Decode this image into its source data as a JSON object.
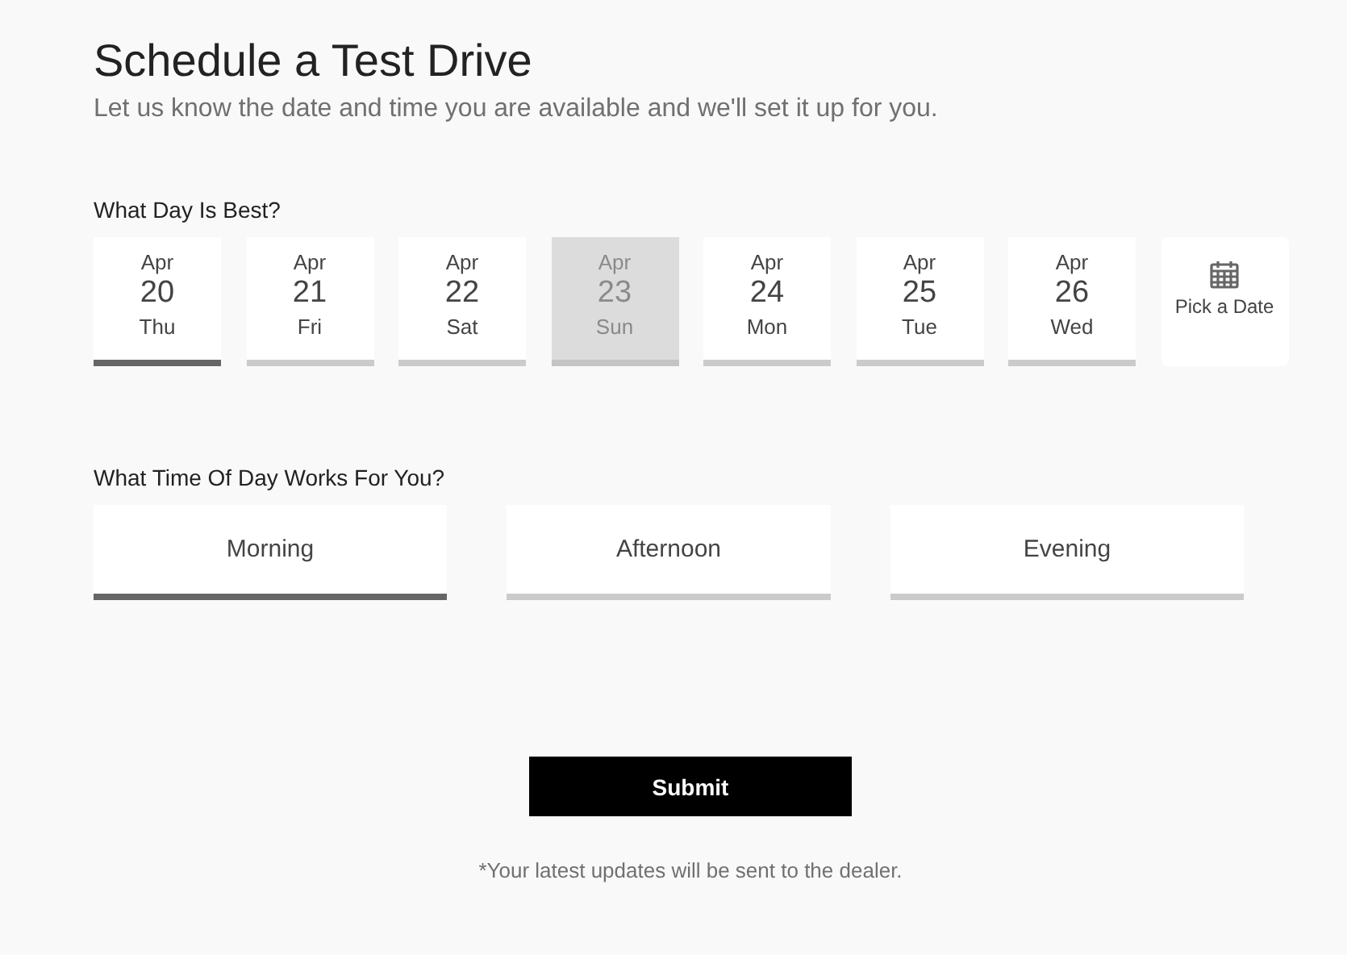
{
  "title": "Schedule a Test Drive",
  "subtitle": "Let us know the date and time you are available and we'll set it up for you.",
  "day_section": {
    "heading": "What Day Is Best?",
    "days": [
      {
        "kind": "date",
        "month": "Apr",
        "day": "20",
        "weekday": "Thu",
        "selected": true,
        "disabled": false
      },
      {
        "kind": "date",
        "month": "Apr",
        "day": "21",
        "weekday": "Fri",
        "selected": false,
        "disabled": false
      },
      {
        "kind": "date",
        "month": "Apr",
        "day": "22",
        "weekday": "Sat",
        "selected": false,
        "disabled": false
      },
      {
        "kind": "date",
        "month": "Apr",
        "day": "23",
        "weekday": "Sun",
        "selected": false,
        "disabled": true
      },
      {
        "kind": "date",
        "month": "Apr",
        "day": "24",
        "weekday": "Mon",
        "selected": false,
        "disabled": false
      },
      {
        "kind": "date",
        "month": "Apr",
        "day": "25",
        "weekday": "Tue",
        "selected": false,
        "disabled": false
      },
      {
        "kind": "date",
        "month": "Apr",
        "day": "26",
        "weekday": "Wed",
        "selected": false,
        "disabled": false
      },
      {
        "kind": "picker",
        "label": "Pick a Date"
      }
    ]
  },
  "time_section": {
    "heading": "What Time Of Day Works For You?",
    "options": [
      {
        "label": "Morning",
        "selected": true
      },
      {
        "label": "Afternoon",
        "selected": false
      },
      {
        "label": "Evening",
        "selected": false
      }
    ]
  },
  "submit": "Submit",
  "footnote": "*Your latest updates will be sent to the dealer."
}
